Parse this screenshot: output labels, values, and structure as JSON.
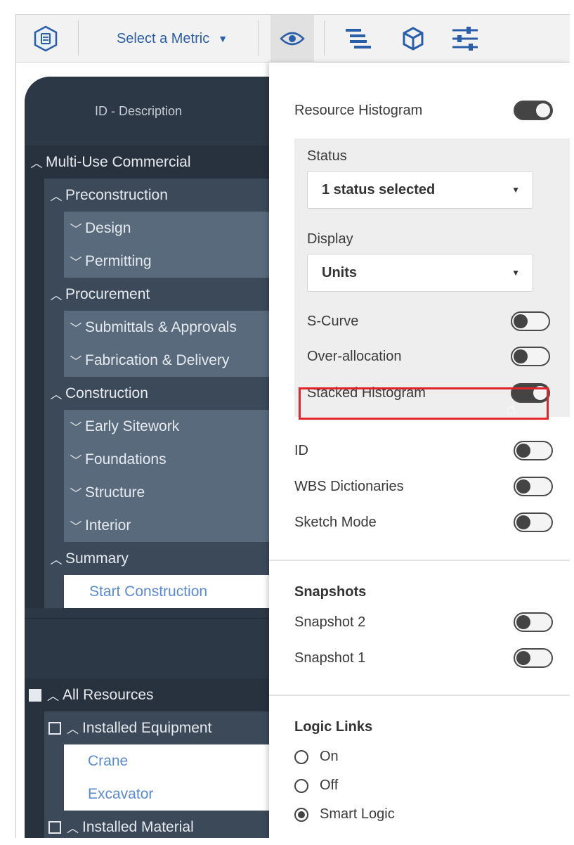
{
  "toolbar": {
    "metric_label": "Select a Metric",
    "icons": [
      "hexagon-logo-icon",
      "chevron-down-icon",
      "eye-icon",
      "bar-lines-icon",
      "cube-icon",
      "sliders-icon"
    ]
  },
  "left_panel": {
    "header": "ID - Description",
    "tree": [
      {
        "label": "Multi-Use Commercial",
        "level": 0,
        "chevron": "^"
      },
      {
        "label": "Preconstruction",
        "level": 1,
        "chevron": "^"
      },
      {
        "label": "Design",
        "level": 2,
        "chevron": "v"
      },
      {
        "label": "Permitting",
        "level": 2,
        "chevron": "v"
      },
      {
        "label": "Procurement",
        "level": 1,
        "chevron": "^"
      },
      {
        "label": "Submittals & Approvals",
        "level": 2,
        "chevron": "v"
      },
      {
        "label": "Fabrication & Delivery",
        "level": 2,
        "chevron": "v"
      },
      {
        "label": "Construction",
        "level": 1,
        "chevron": "^"
      },
      {
        "label": "Early Sitework",
        "level": 2,
        "chevron": "v"
      },
      {
        "label": "Foundations",
        "level": 2,
        "chevron": "v"
      },
      {
        "label": "Structure",
        "level": 2,
        "chevron": "v"
      },
      {
        "label": "Interior",
        "level": 2,
        "chevron": "v"
      },
      {
        "label": "Summary",
        "level": 1,
        "chevron": "^"
      },
      {
        "label": "Start Construction",
        "level": 3,
        "chevron": ""
      }
    ],
    "resources": [
      {
        "label": "All Resources",
        "level": 0
      },
      {
        "label": "Installed Equipment",
        "level": 1
      },
      {
        "label": "Crane",
        "level": 2
      },
      {
        "label": "Excavator",
        "level": 2
      },
      {
        "label": "Installed Material",
        "level": 1
      }
    ]
  },
  "right_panel": {
    "resource_histogram": {
      "label": "Resource Histogram",
      "on": true
    },
    "status": {
      "label": "Status",
      "value": "1 status selected"
    },
    "display": {
      "label": "Display",
      "value": "Units"
    },
    "s_curve": {
      "label": "S-Curve",
      "on": false
    },
    "over_allocation": {
      "label": "Over-allocation",
      "on": false
    },
    "stacked_histogram": {
      "label": "Stacked Histogram",
      "on": true
    },
    "id": {
      "label": "ID",
      "on": false
    },
    "wbs_dictionaries": {
      "label": "WBS Dictionaries",
      "on": false
    },
    "sketch_mode": {
      "label": "Sketch Mode",
      "on": false
    },
    "snapshots": {
      "title": "Snapshots",
      "items": [
        {
          "label": "Snapshot 2",
          "on": false
        },
        {
          "label": "Snapshot 1",
          "on": false
        }
      ]
    },
    "logic_links": {
      "title": "Logic Links",
      "options": [
        {
          "label": "On",
          "checked": false
        },
        {
          "label": "Off",
          "checked": false
        },
        {
          "label": "Smart Logic",
          "checked": true
        }
      ]
    }
  },
  "colors": {
    "accent": "#2a5ea8",
    "highlight": "#e3232a",
    "tree_dark": "#27323e",
    "tree_mid": "#3b4959",
    "tree_light": "#5a6a7d"
  }
}
